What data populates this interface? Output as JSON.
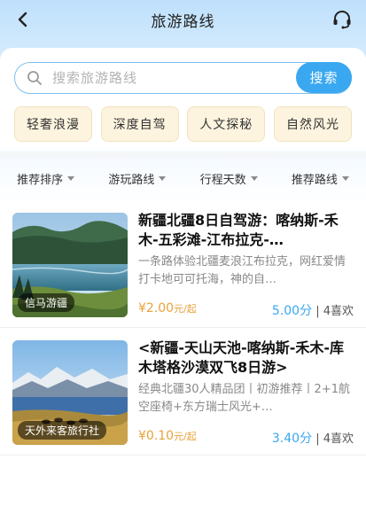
{
  "header": {
    "title": "旅游路线",
    "back_icon": "chevron-left-icon",
    "service_icon": "headset-icon"
  },
  "search": {
    "placeholder": "搜索旅游路线",
    "button_label": "搜索",
    "value": ""
  },
  "categories": [
    {
      "label": "轻奢浪漫"
    },
    {
      "label": "深度自驾"
    },
    {
      "label": "人文探秘"
    },
    {
      "label": "自然风光"
    }
  ],
  "filters": [
    {
      "label": "推荐排序"
    },
    {
      "label": "游玩路线"
    },
    {
      "label": "行程天数"
    },
    {
      "label": "推荐路线"
    }
  ],
  "routes": [
    {
      "title": "新疆北疆8日自驾游：喀纳斯-禾木-五彩滩-江布拉克-…",
      "description": "一条路体验北疆麦浪江布拉克，网红爱情打卡地可可托海，神的自…",
      "price": "¥2.00",
      "price_unit": "元/起",
      "score": "5.00分",
      "likes": "4喜欢",
      "vendor": "信马游疆"
    },
    {
      "title": "<新疆-天山天池-喀纳斯-禾木-库木塔格沙漠双飞8日游>",
      "description": "经典北疆30人精品团丨初游推荐丨2+1航空座椅+东方瑞士风光+…",
      "price": "¥0.10",
      "price_unit": "元/起",
      "score": "3.40分",
      "likes": "4喜欢",
      "vendor": "天外来客旅行社"
    }
  ],
  "colors": {
    "accent": "#3aa8f0",
    "price": "#e8a23a",
    "category_bg": "#fdf4df"
  }
}
